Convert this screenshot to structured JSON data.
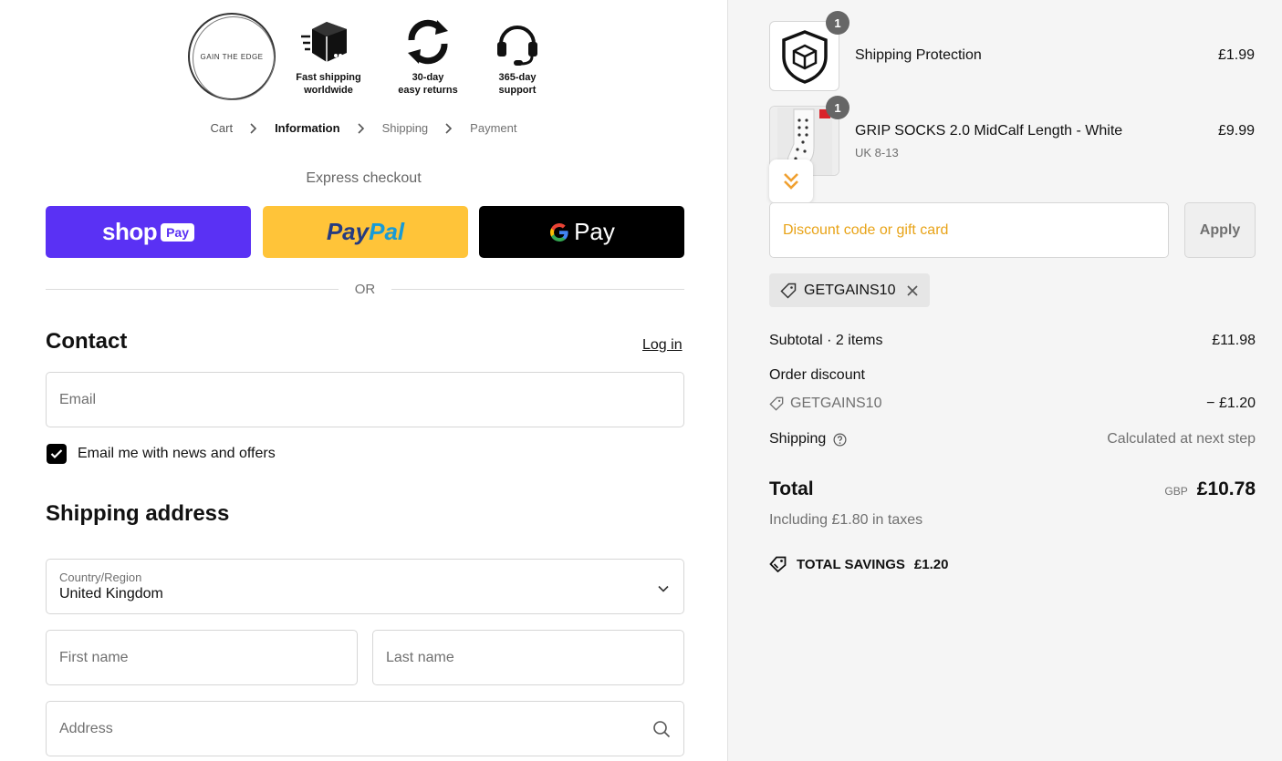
{
  "header": {
    "logo_text": "GAIN THE EDGE",
    "badges": [
      {
        "icon": "box-icon",
        "label": "Fast shipping\nworldwide"
      },
      {
        "icon": "refresh-icon",
        "label": "30-day\neasy returns"
      },
      {
        "icon": "headset-icon",
        "label": "365-day\nsupport"
      }
    ]
  },
  "breadcrumb": {
    "items": [
      "Cart",
      "Information",
      "Shipping",
      "Payment"
    ],
    "active_index": 1
  },
  "express": {
    "title": "Express checkout",
    "shop_pay": "shop",
    "shop_pay_tag": "Pay",
    "paypal_a": "Pay",
    "paypal_b": "Pal",
    "gpay": "Pay",
    "or_label": "OR"
  },
  "contact": {
    "heading": "Contact",
    "login_link": "Log in",
    "email_placeholder": "Email",
    "newsletter_label": "Email me with news and offers",
    "newsletter_checked": true
  },
  "shipping_address": {
    "heading": "Shipping address",
    "country_label": "Country/Region",
    "country_value": "United Kingdom",
    "first_name_placeholder": "First name",
    "last_name_placeholder": "Last name",
    "address_placeholder": "Address"
  },
  "order": {
    "items": [
      {
        "name": "Shipping Protection",
        "variant": "",
        "price": "£1.99",
        "qty": "1",
        "icon": "shield-box-icon"
      },
      {
        "name": "GRIP SOCKS 2.0 MidCalf Length - White",
        "variant": "UK 8-13",
        "price": "£9.99",
        "qty": "1",
        "icon": "sock-image"
      }
    ],
    "discount_placeholder": "Discount code or gift card",
    "apply_label": "Apply",
    "applied_code": "GETGAINS10",
    "subtotal_label": "Subtotal · 2 items",
    "subtotal_value": "£11.98",
    "order_discount_label": "Order discount",
    "discount_code": "GETGAINS10",
    "discount_value": "− £1.20",
    "shipping_label": "Shipping",
    "shipping_value": "Calculated at next step",
    "total_label": "Total",
    "currency": "GBP",
    "total_value": "£10.78",
    "tax_note": "Including £1.80 in taxes",
    "savings_label": "TOTAL SAVINGS",
    "savings_value": "£1.20"
  },
  "colors": {
    "shop_pay": "#5a31f4",
    "paypal": "#ffc439",
    "gpay": "#000000",
    "discount_text": "#e8a317"
  }
}
